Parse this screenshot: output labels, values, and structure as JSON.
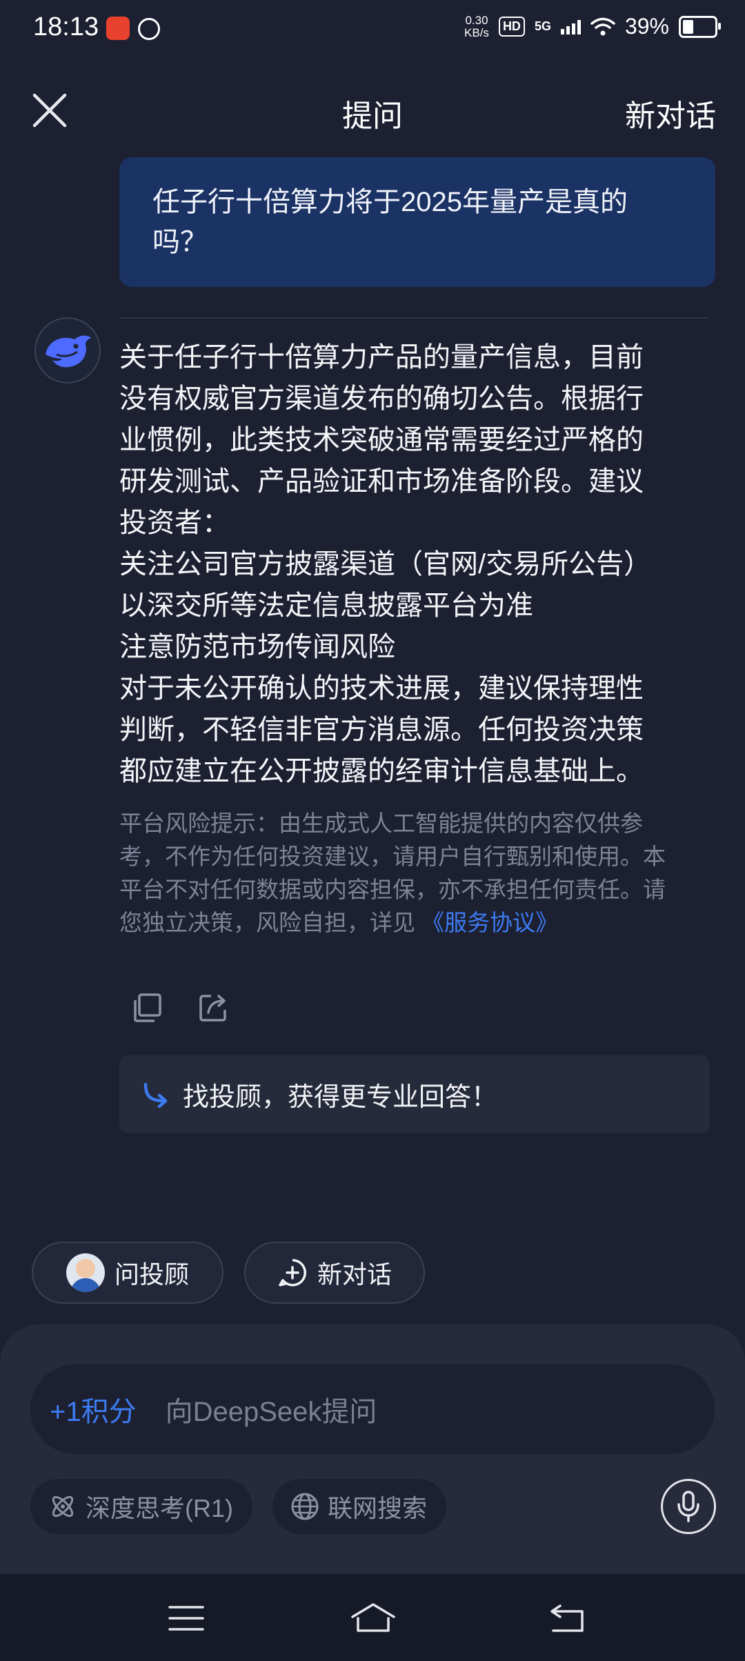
{
  "status_bar": {
    "time": "18:13",
    "net_speed_value": "0.30",
    "net_speed_unit": "KB/s",
    "hd": "HD",
    "network": "5G",
    "battery": "39%",
    "battery_level": 0.39
  },
  "header": {
    "title": "提问",
    "new_chat": "新对话"
  },
  "conversation": {
    "user_question_lines": [
      "任子行十倍算力将于2025年量产是真的",
      "吗？"
    ],
    "answer_lines": [
      "关于任子行十倍算力产品的量产信息，目前",
      "没有权威官方渠道发布的确切公告。根据行",
      "业惯例，此类技术突破通常需要经过严格的",
      "研发测试、产品验证和市场准备阶段。建议",
      "投资者：",
      "关注公司官方披露渠道（官网/交易所公告）",
      "以深交所等法定信息披露平台为准",
      "注意防范市场传闻风险",
      "对于未公开确认的技术进展，建议保持理性",
      "判断，不轻信非官方消息源。任何投资决策",
      "都应建立在公开披露的经审计信息基础上。"
    ],
    "disclaimer_lines": [
      "平台风险提示：由生成式人工智能提供的内容仅供参",
      "考，不作为任何投资建议，请用户自行甄别和使用。本",
      "平台不对任何数据或内容担保，亦不承担任何责任。请",
      "您独立决策，风险自担，详见"
    ],
    "service_link": "《服务协议》",
    "advisor_banner": "找投顾，获得更专业回答！"
  },
  "chips": {
    "ask_advisor": "问投顾",
    "new_chat": "新对话"
  },
  "composer": {
    "points": "+1积分",
    "placeholder": "向DeepSeek提问",
    "deep_think": "深度思考(R1)",
    "web_search": "联网搜索"
  },
  "colors": {
    "background": "#1c2031",
    "user_bubble": "#1b3264",
    "accent": "#3d7bf2",
    "whale": "#4d6bfe"
  },
  "icons": [
    "close-icon",
    "whale-logo-icon",
    "copy-icon",
    "share-icon",
    "arrow-icon",
    "plus-circle-icon",
    "atom-icon",
    "globe-icon",
    "mic-icon",
    "menu-icon",
    "home-icon",
    "back-icon"
  ]
}
